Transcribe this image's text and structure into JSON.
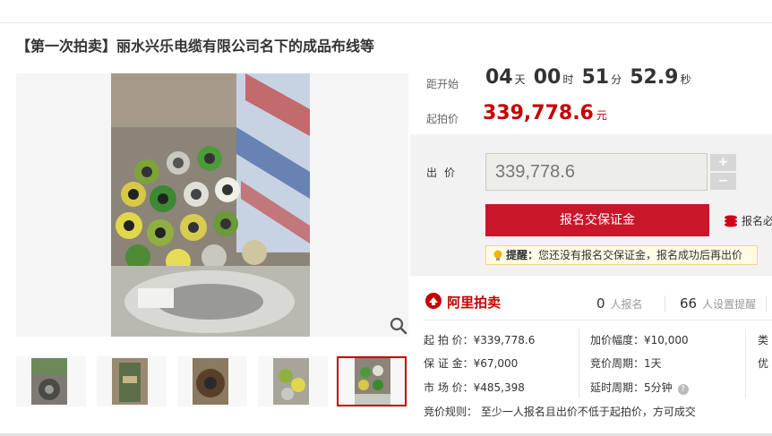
{
  "title": "【第一次拍卖】丽水兴乐电缆有限公司名下的成品布线等",
  "countdown": {
    "label": "距开始",
    "days": "04",
    "days_unit": "天",
    "hours": "00",
    "hours_unit": "时",
    "minutes": "51",
    "minutes_unit": "分",
    "seconds": "52.9",
    "seconds_unit": "秒"
  },
  "start_price": {
    "label": "起拍价",
    "value": "339,778.6",
    "currency": "元"
  },
  "bid": {
    "label": "出价",
    "value": "339,778.6",
    "plus": "+",
    "minus": "−",
    "register_button": "报名交保证金",
    "apply_link": "报名必",
    "tip_head": "提醒：",
    "tip_text": "您还没有报名交保证金，报名成功后再出价"
  },
  "ali": {
    "logo_text": "阿里拍卖",
    "registered_count": "0",
    "registered_label": "人报名",
    "reminder_count": "66",
    "reminder_label": "人设置提醒"
  },
  "details": {
    "start_price": "起 拍 价：¥339,778.6",
    "deposit": "保 证 金：¥67,000",
    "market_price": "市 场 价：¥485,398",
    "increment": "加价幅度：¥10,000",
    "cycle": "竞价周期：1天",
    "delay": "延时周期：5分钟",
    "col3_a": "类",
    "col3_b": "优",
    "rule": "竞价规则：  至少一人报名且出价不低于起拍价，方可成交"
  },
  "colors": {
    "accent": "#c40000",
    "button": "#c8162b",
    "tip_bg": "#fffbe6"
  }
}
